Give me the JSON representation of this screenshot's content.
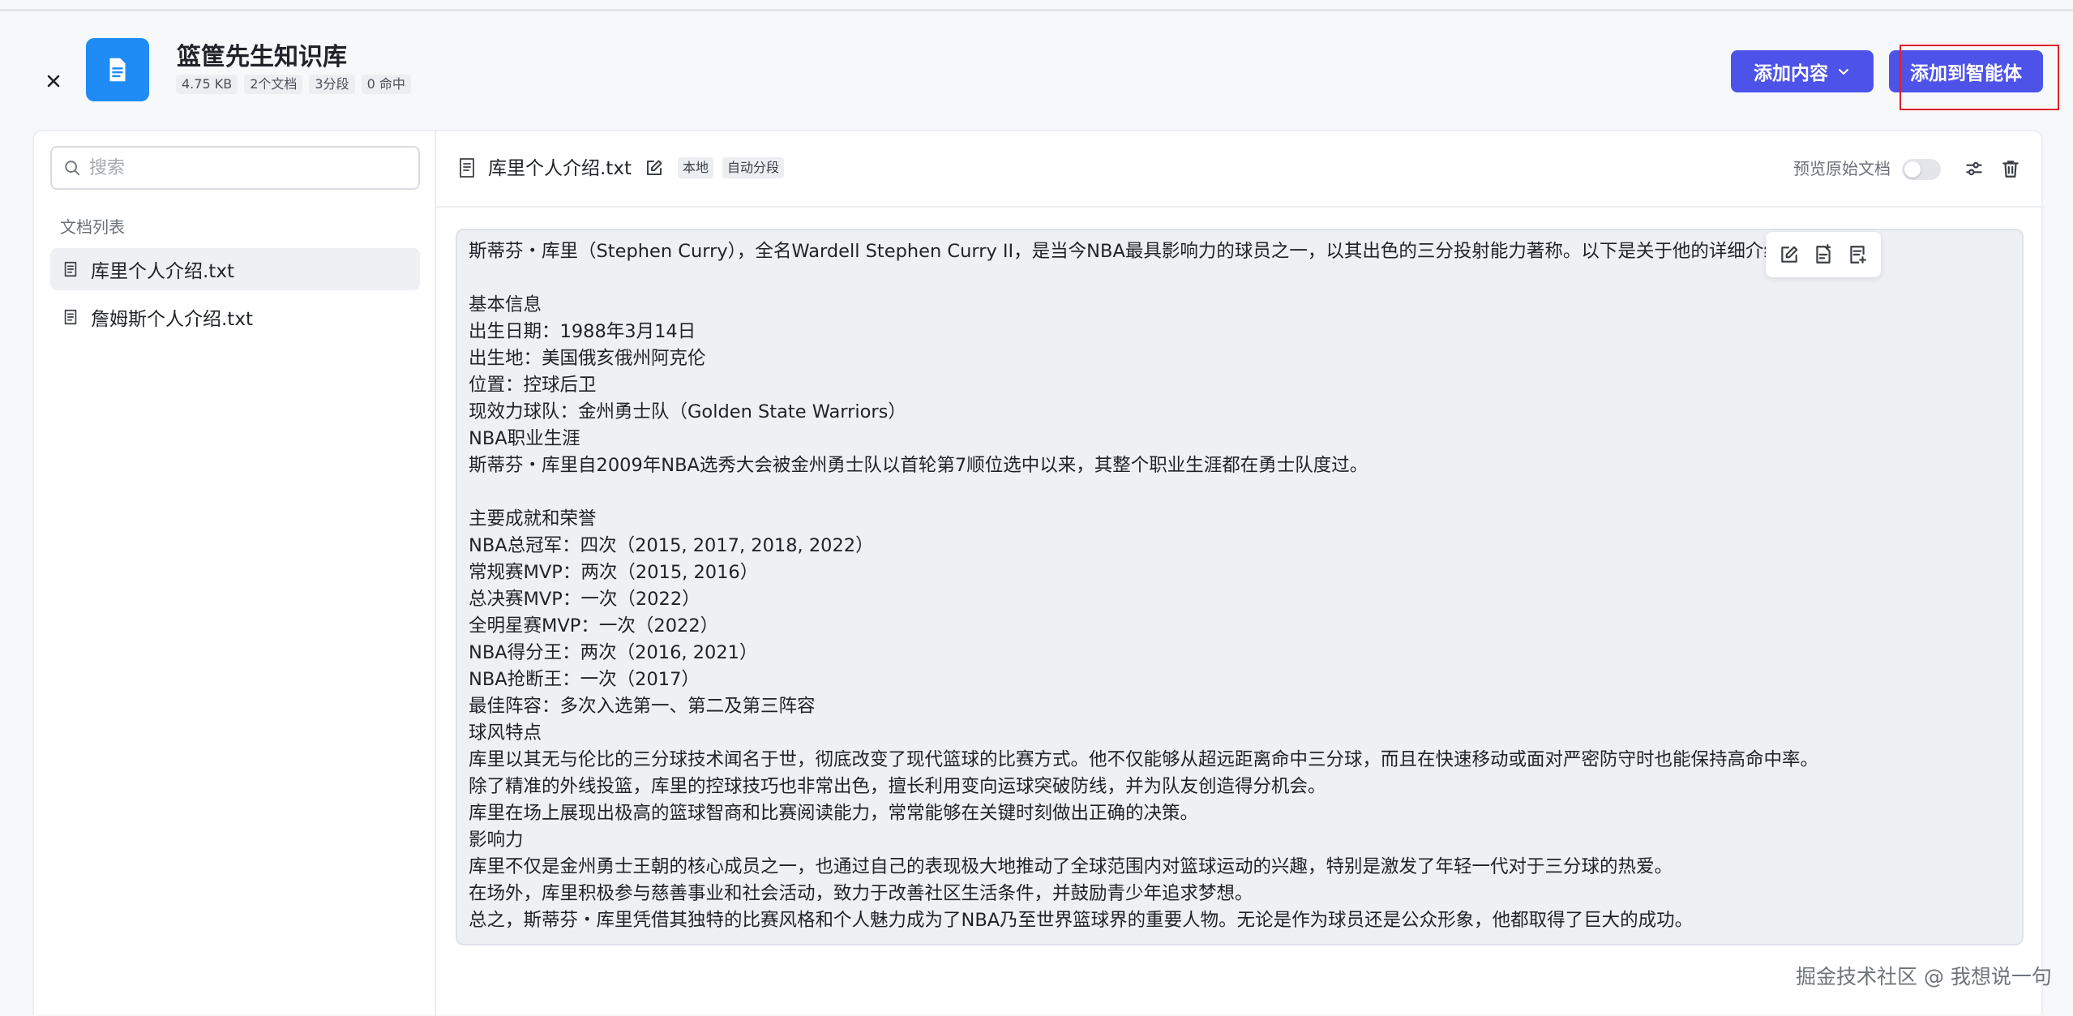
{
  "header": {
    "title": "篮筐先生知识库",
    "stats": [
      "4.75 KB",
      "2个文档",
      "3分段",
      "0 命中"
    ],
    "add_content_label": "添加内容",
    "add_agent_label": "添加到智能体"
  },
  "sidebar": {
    "search_placeholder": "搜索",
    "list_title": "文档列表",
    "docs": [
      {
        "name": "库里个人介绍.txt",
        "active": true
      },
      {
        "name": "詹姆斯个人介绍.txt",
        "active": false
      }
    ]
  },
  "document": {
    "name": "库里个人介绍.txt",
    "tags": [
      "本地",
      "自动分段"
    ],
    "preview_label": "预览原始文档",
    "preview_enabled": false,
    "content": "斯蒂芬・库里（Stephen Curry），全名Wardell Stephen Curry II，是当今NBA最具影响力的球员之一，以其出色的三分投射能力著称。以下是关于他的详细介绍：\n\n基本信息\n出生日期：1988年3月14日\n出生地：美国俄亥俄州阿克伦\n位置：控球后卫\n现效力球队：金州勇士队（Golden State Warriors）\nNBA职业生涯\n斯蒂芬・库里自2009年NBA选秀大会被金州勇士队以首轮第7顺位选中以来，其整个职业生涯都在勇士队度过。\n\n主要成就和荣誉\nNBA总冠军：四次（2015, 2017, 2018, 2022）\n常规赛MVP：两次（2015, 2016）\n总决赛MVP：一次（2022）\n全明星赛MVP：一次（2022）\nNBA得分王：两次（2016, 2021）\nNBA抢断王：一次（2017）\n最佳阵容：多次入选第一、第二及第三阵容\n球风特点\n库里以其无与伦比的三分球技术闻名于世，彻底改变了现代篮球的比赛方式。他不仅能够从超远距离命中三分球，而且在快速移动或面对严密防守时也能保持高命中率。\n除了精准的外线投篮，库里的控球技巧也非常出色，擅长利用变向运球突破防线，并为队友创造得分机会。\n库里在场上展现出极高的篮球智商和比赛阅读能力，常常能够在关键时刻做出正确的决策。\n影响力\n库里不仅是金州勇士王朝的核心成员之一，也通过自己的表现极大地推动了全球范围内对篮球运动的兴趣，特别是激发了年轻一代对于三分球的热爱。\n在场外，库里积极参与慈善事业和社会活动，致力于改善社区生活条件，并鼓励青少年追求梦想。\n总之，斯蒂芬・库里凭借其独特的比赛风格和个人魅力成为了NBA乃至世界篮球界的重要人物。无论是作为球员还是公众形象，他都取得了巨大的成功。"
  },
  "watermark": "掘金技术社区 @ 我想说一句",
  "colors": {
    "primary": "#4d53e8",
    "kb_icon": "#1f8cf5",
    "highlight": "#e0202a"
  },
  "icons": [
    "close-icon",
    "document-icon",
    "chevron-down-icon",
    "search-icon",
    "edit-icon",
    "settings-icon",
    "trash-icon",
    "add-segment-above-icon",
    "add-segment-below-icon"
  ]
}
